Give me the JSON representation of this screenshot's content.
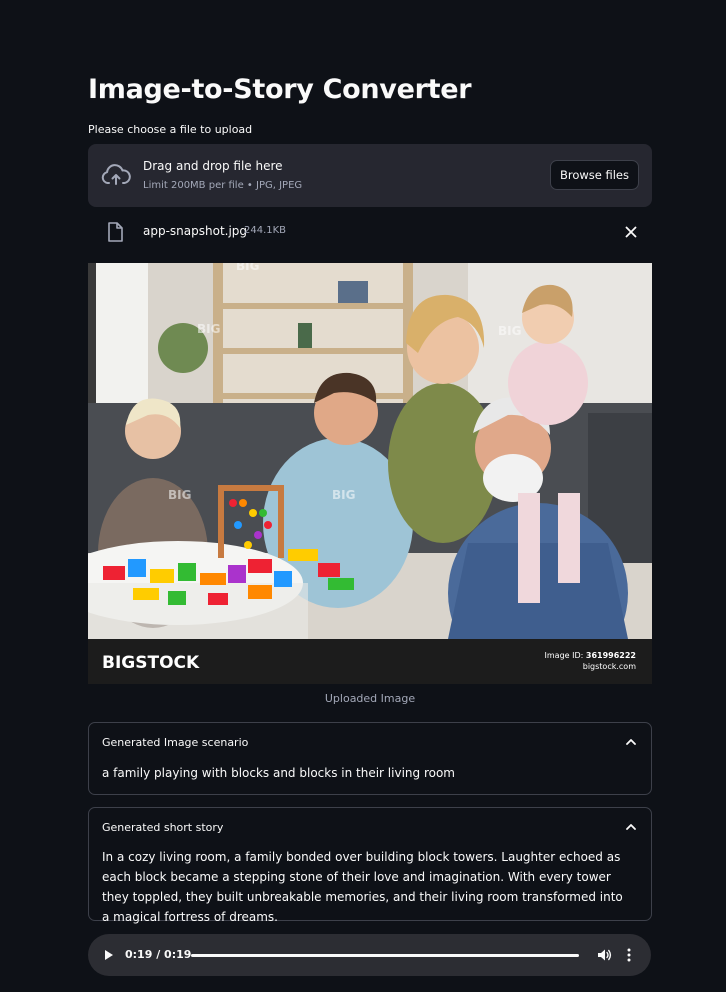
{
  "app": {
    "title": "Image-to-Story Converter"
  },
  "uploader": {
    "label": "Please choose a file to upload",
    "dropzone_title": "Drag and drop file here",
    "dropzone_hint": "Limit 200MB per file • JPG, JPEG",
    "browse_label": "Browse files",
    "icon": "cloud-upload-icon"
  },
  "file": {
    "name": "app-snapshot.jpg",
    "size": "244.1KB",
    "icon": "file-icon",
    "remove_icon": "close-icon"
  },
  "image": {
    "brand": "BIGSTOCK",
    "watermark": "BIG",
    "image_id_label": "Image ID:",
    "image_id": "361996222",
    "site": "bigstock.com",
    "caption": "Uploaded Image"
  },
  "scenario": {
    "header": "Generated Image scenario",
    "text": "a family playing with blocks and blocks in their living room"
  },
  "story": {
    "header": "Generated short story",
    "text": "In a cozy living room, a family bonded over building block towers. Laughter echoed as each block became a stepping stone of their love and imagination. With every tower they toppled, they built unbreakable memories, and their living room transformed into a magical fortress of dreams."
  },
  "audio": {
    "time": "0:19 / 0:19",
    "progress_fraction": 1.0
  },
  "colors": {
    "background": "#0e1117",
    "surface": "#262730",
    "border": "#3d404a",
    "muted_text": "#a3a8b8",
    "audio_bar": "#2c2d33"
  }
}
